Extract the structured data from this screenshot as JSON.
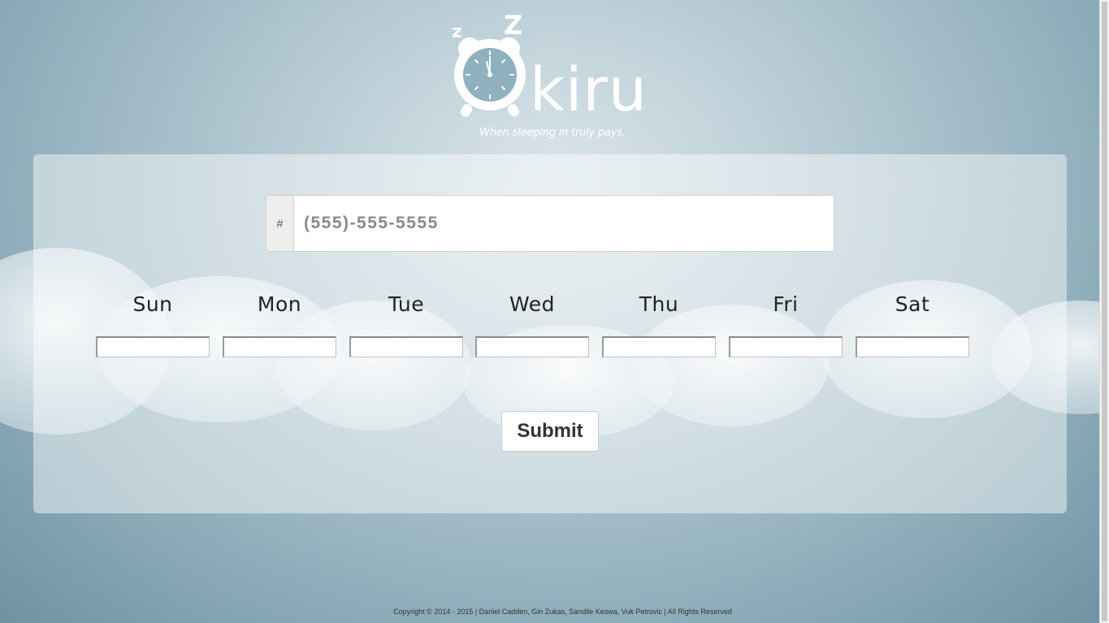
{
  "brand": {
    "name": "kiru",
    "snore": [
      "z",
      "Z"
    ],
    "tagline": "When sleeping in truly pays."
  },
  "form": {
    "phone": {
      "addon": "#",
      "placeholder": "(555)-555-5555",
      "value": ""
    },
    "days": [
      {
        "label": "Sun",
        "value": ""
      },
      {
        "label": "Mon",
        "value": ""
      },
      {
        "label": "Tue",
        "value": ""
      },
      {
        "label": "Wed",
        "value": ""
      },
      {
        "label": "Thu",
        "value": ""
      },
      {
        "label": "Fri",
        "value": ""
      },
      {
        "label": "Sat",
        "value": ""
      }
    ],
    "submit_label": "Submit"
  },
  "footer": {
    "copyright": "Copyright © 2014 - 2015 | Daniel Cadden, Gin Zukas, Sandile Keswa, Vuk Petrovic | All Rights Reserved"
  },
  "colors": {
    "accent_text": "#222222",
    "panel": "rgba(255,255,255,0.45)",
    "logo": "#ffffff"
  }
}
